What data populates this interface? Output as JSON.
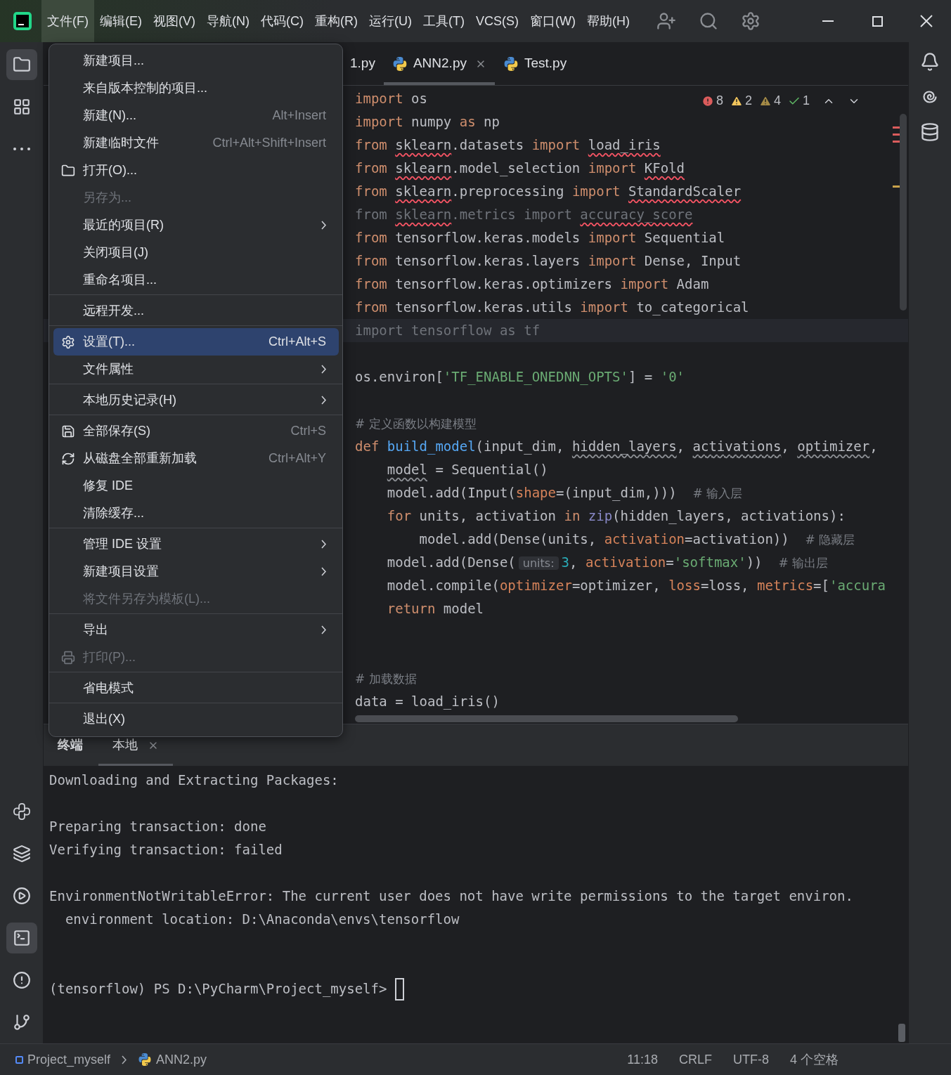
{
  "menubar": [
    {
      "label": "文件(F)",
      "selected": true
    },
    {
      "label": "编辑(E)",
      "selected": false
    },
    {
      "label": "视图(V)",
      "selected": false
    },
    {
      "label": "导航(N)",
      "selected": false
    },
    {
      "label": "代码(C)",
      "selected": false
    },
    {
      "label": "重构(R)",
      "selected": false
    },
    {
      "label": "运行(U)",
      "selected": false
    },
    {
      "label": "工具(T)",
      "selected": false
    },
    {
      "label": "VCS(S)",
      "selected": false
    },
    {
      "label": "窗口(W)",
      "selected": false
    },
    {
      "label": "帮助(H)",
      "selected": false
    }
  ],
  "tool_windows": {
    "top": [
      {
        "selected": true
      },
      {
        "selected": false
      },
      {
        "selected": false
      }
    ],
    "bottom": [
      {
        "selected": false
      },
      {
        "selected": false
      },
      {
        "selected": false
      },
      {
        "selected": true
      },
      {
        "selected": false
      },
      {
        "selected": false
      }
    ]
  },
  "editor": {
    "tabs": [
      {
        "label": "1.py",
        "selected": false,
        "python": false,
        "closable": false
      },
      {
        "label": "ANN2.py",
        "selected": true,
        "python": true,
        "closable": true
      },
      {
        "label": "Test.py",
        "selected": false,
        "python": true,
        "closable": false
      }
    ],
    "inspections": [
      {
        "kind": "error",
        "count": "8"
      },
      {
        "kind": "warning",
        "count": "2"
      },
      {
        "kind": "weak",
        "count": "4"
      },
      {
        "kind": "typo",
        "count": "1"
      }
    ],
    "lines": [
      {
        "kind": "code",
        "current": false,
        "tokens": [
          {
            "text": "import ",
            "kind": "kw"
          },
          {
            "text": "os",
            "kind": "plain"
          }
        ]
      },
      {
        "kind": "code",
        "current": false,
        "tokens": [
          {
            "text": "import ",
            "kind": "kw"
          },
          {
            "text": "numpy ",
            "kind": "plain"
          },
          {
            "text": "as ",
            "kind": "kw"
          },
          {
            "text": "np",
            "kind": "plain"
          }
        ]
      },
      {
        "kind": "code",
        "current": false,
        "tokens": [
          {
            "text": "from ",
            "kind": "kw"
          },
          {
            "text": "sklearn",
            "kind": "plain",
            "error": true
          },
          {
            "text": ".datasets ",
            "kind": "plain"
          },
          {
            "text": "import ",
            "kind": "kw"
          },
          {
            "text": "load_iris",
            "kind": "plain",
            "error": true
          }
        ]
      },
      {
        "kind": "code",
        "current": false,
        "tokens": [
          {
            "text": "from ",
            "kind": "kw"
          },
          {
            "text": "sklearn",
            "kind": "plain",
            "error": true
          },
          {
            "text": ".model_selection ",
            "kind": "plain"
          },
          {
            "text": "import ",
            "kind": "kw"
          },
          {
            "text": "KFold",
            "kind": "plain",
            "error": true
          }
        ]
      },
      {
        "kind": "code",
        "current": false,
        "tokens": [
          {
            "text": "from ",
            "kind": "kw"
          },
          {
            "text": "sklearn",
            "kind": "plain",
            "error": true
          },
          {
            "text": ".preprocessing ",
            "kind": "plain"
          },
          {
            "text": "import ",
            "kind": "kw"
          },
          {
            "text": "StandardScaler",
            "kind": "plain",
            "error": true
          }
        ]
      },
      {
        "kind": "code",
        "current": false,
        "tokens": [
          {
            "text": "from ",
            "kind": "dim"
          },
          {
            "text": "sklearn",
            "kind": "dim",
            "error": true
          },
          {
            "text": ".metrics import ",
            "kind": "dim"
          },
          {
            "text": "accuracy_score",
            "kind": "dim",
            "error": true
          }
        ]
      },
      {
        "kind": "code",
        "current": false,
        "tokens": [
          {
            "text": "from ",
            "kind": "kw"
          },
          {
            "text": "tensorflow.keras.models ",
            "kind": "plain"
          },
          {
            "text": "import ",
            "kind": "kw"
          },
          {
            "text": "Sequential",
            "kind": "plain"
          }
        ]
      },
      {
        "kind": "code",
        "current": false,
        "tokens": [
          {
            "text": "from ",
            "kind": "kw"
          },
          {
            "text": "tensorflow.keras.layers ",
            "kind": "plain"
          },
          {
            "text": "import ",
            "kind": "kw"
          },
          {
            "text": "Dense, Input",
            "kind": "plain"
          }
        ]
      },
      {
        "kind": "code",
        "current": false,
        "tokens": [
          {
            "text": "from ",
            "kind": "kw"
          },
          {
            "text": "tensorflow.keras.optimizers ",
            "kind": "plain"
          },
          {
            "text": "import ",
            "kind": "kw"
          },
          {
            "text": "Adam",
            "kind": "plain"
          }
        ]
      },
      {
        "kind": "code",
        "current": false,
        "tokens": [
          {
            "text": "from ",
            "kind": "kw"
          },
          {
            "text": "tensorflow.keras.utils ",
            "kind": "plain"
          },
          {
            "text": "import ",
            "kind": "kw"
          },
          {
            "text": "to_categorical",
            "kind": "plain"
          }
        ]
      },
      {
        "kind": "code",
        "current": true,
        "tokens": [
          {
            "text": "import tensorflow as tf",
            "kind": "dim"
          }
        ]
      },
      {
        "kind": "blank"
      },
      {
        "kind": "code",
        "current": false,
        "tokens": [
          {
            "text": "os.environ[",
            "kind": "plain"
          },
          {
            "text": "'TF_ENABLE_ONEDNN_OPTS'",
            "kind": "str"
          },
          {
            "text": "] = ",
            "kind": "plain"
          },
          {
            "text": "'0'",
            "kind": "str"
          }
        ]
      },
      {
        "kind": "blank"
      },
      {
        "kind": "code",
        "current": false,
        "tokens": [
          {
            "text": "# 定义函数以构建模型",
            "kind": "comment"
          }
        ]
      },
      {
        "kind": "code",
        "current": false,
        "tokens": [
          {
            "text": "def ",
            "kind": "kw"
          },
          {
            "text": "build_model",
            "kind": "fn"
          },
          {
            "text": "(input_dim, ",
            "kind": "plain"
          },
          {
            "text": "hidden_layers",
            "kind": "plain",
            "weak": true
          },
          {
            "text": ", ",
            "kind": "plain"
          },
          {
            "text": "activations",
            "kind": "plain",
            "weak": true
          },
          {
            "text": ", ",
            "kind": "plain"
          },
          {
            "text": "optimizer",
            "kind": "plain",
            "weak": true
          },
          {
            "text": ",",
            "kind": "plain"
          }
        ]
      },
      {
        "kind": "code",
        "current": false,
        "tokens": [
          {
            "text": "    model",
            "kind": "plain",
            "weak": true
          },
          {
            "text": " = Sequential()",
            "kind": "plain"
          }
        ]
      },
      {
        "kind": "code",
        "current": false,
        "tokens": [
          {
            "text": "    model.add(Input(",
            "kind": "plain"
          },
          {
            "text": "shape",
            "kind": "param"
          },
          {
            "text": "=(input_dim,)))  ",
            "kind": "plain"
          },
          {
            "text": "# 输入层",
            "kind": "comment"
          }
        ]
      },
      {
        "kind": "code",
        "current": false,
        "tokens": [
          {
            "text": "    for ",
            "kind": "kw"
          },
          {
            "text": "units, activation ",
            "kind": "plain"
          },
          {
            "text": "in ",
            "kind": "kw"
          },
          {
            "text": "zip",
            "kind": "builtin"
          },
          {
            "text": "(hidden_layers, activations):",
            "kind": "plain"
          }
        ]
      },
      {
        "kind": "code",
        "current": false,
        "tokens": [
          {
            "text": "        model.add(Dense(units, ",
            "kind": "plain"
          },
          {
            "text": "activation",
            "kind": "param"
          },
          {
            "text": "=activation))  ",
            "kind": "plain"
          },
          {
            "text": "# 隐藏层",
            "kind": "comment"
          }
        ]
      },
      {
        "kind": "code",
        "current": false,
        "tokens": [
          {
            "text": "    model.add(Dense(",
            "kind": "plain"
          },
          {
            "text": "units:",
            "kind": "hint"
          },
          {
            "text": "3",
            "kind": "num"
          },
          {
            "text": ", ",
            "kind": "plain"
          },
          {
            "text": "activation",
            "kind": "param"
          },
          {
            "text": "=",
            "kind": "plain"
          },
          {
            "text": "'softmax'",
            "kind": "str"
          },
          {
            "text": "))  ",
            "kind": "plain"
          },
          {
            "text": "# 输出层",
            "kind": "comment"
          }
        ]
      },
      {
        "kind": "code",
        "current": false,
        "tokens": [
          {
            "text": "    model.compile(",
            "kind": "plain"
          },
          {
            "text": "optimizer",
            "kind": "param"
          },
          {
            "text": "=optimizer, ",
            "kind": "plain"
          },
          {
            "text": "loss",
            "kind": "param"
          },
          {
            "text": "=loss, ",
            "kind": "plain"
          },
          {
            "text": "metrics",
            "kind": "param"
          },
          {
            "text": "=[",
            "kind": "plain"
          },
          {
            "text": "'accura",
            "kind": "str"
          }
        ]
      },
      {
        "kind": "code",
        "current": false,
        "tokens": [
          {
            "text": "    return ",
            "kind": "kw"
          },
          {
            "text": "model",
            "kind": "plain"
          }
        ]
      },
      {
        "kind": "blank"
      },
      {
        "kind": "blank"
      },
      {
        "kind": "code",
        "current": false,
        "tokens": [
          {
            "text": "# 加载数据",
            "kind": "comment"
          }
        ]
      },
      {
        "kind": "code",
        "current": false,
        "tokens": [
          {
            "text": "data = load_iris()",
            "kind": "plain"
          }
        ]
      }
    ]
  },
  "file_menu": {
    "groups": [
      {
        "items": [
          {
            "label": "新建项目...",
            "selected": false,
            "disabled": false,
            "submenu": false
          },
          {
            "label": "来自版本控制的项目...",
            "selected": false,
            "disabled": false,
            "submenu": false
          },
          {
            "label": "新建(N)...",
            "shortcut": "Alt+Insert",
            "selected": false,
            "disabled": false,
            "submenu": false
          },
          {
            "label": "新建临时文件",
            "shortcut": "Ctrl+Alt+Shift+Insert",
            "selected": false,
            "disabled": false,
            "submenu": false
          },
          {
            "label": "打开(O)...",
            "selected": false,
            "disabled": false,
            "submenu": false
          },
          {
            "label": "另存为...",
            "selected": false,
            "disabled": true,
            "submenu": false
          },
          {
            "label": "最近的项目(R)",
            "selected": false,
            "disabled": false,
            "submenu": true
          },
          {
            "label": "关闭项目(J)",
            "selected": false,
            "disabled": false,
            "submenu": false
          },
          {
            "label": "重命名项目...",
            "selected": false,
            "disabled": false,
            "submenu": false
          }
        ]
      },
      {
        "items": [
          {
            "label": "远程开发...",
            "selected": false,
            "disabled": false,
            "submenu": false
          }
        ]
      },
      {
        "items": [
          {
            "label": "设置(T)...",
            "shortcut": "Ctrl+Alt+S",
            "selected": true,
            "disabled": false,
            "submenu": false
          },
          {
            "label": "文件属性",
            "selected": false,
            "disabled": false,
            "submenu": true
          }
        ]
      },
      {
        "items": [
          {
            "label": "本地历史记录(H)",
            "selected": false,
            "disabled": false,
            "submenu": true
          }
        ]
      },
      {
        "items": [
          {
            "label": "全部保存(S)",
            "shortcut": "Ctrl+S",
            "selected": false,
            "disabled": false,
            "submenu": false
          },
          {
            "label": "从磁盘全部重新加载",
            "shortcut": "Ctrl+Alt+Y",
            "selected": false,
            "disabled": false,
            "submenu": false
          },
          {
            "label": "修复 IDE",
            "selected": false,
            "disabled": false,
            "submenu": false
          },
          {
            "label": "清除缓存...",
            "selected": false,
            "disabled": false,
            "submenu": false
          }
        ]
      },
      {
        "items": [
          {
            "label": "管理 IDE 设置",
            "selected": false,
            "disabled": false,
            "submenu": true
          },
          {
            "label": "新建项目设置",
            "selected": false,
            "disabled": false,
            "submenu": true
          },
          {
            "label": "将文件另存为模板(L)...",
            "selected": false,
            "disabled": true,
            "submenu": false
          }
        ]
      },
      {
        "items": [
          {
            "label": "导出",
            "selected": false,
            "disabled": false,
            "submenu": true
          },
          {
            "label": "打印(P)...",
            "selected": false,
            "disabled": true,
            "submenu": false
          }
        ]
      },
      {
        "items": [
          {
            "label": "省电模式",
            "selected": false,
            "disabled": false,
            "submenu": false
          }
        ]
      },
      {
        "items": [
          {
            "label": "退出(X)",
            "selected": false,
            "disabled": false,
            "submenu": false
          }
        ]
      }
    ]
  },
  "terminal": {
    "title": "终端",
    "tabs": [
      {
        "label": "本地",
        "selected": true
      }
    ],
    "lines": [
      {
        "kind": "text",
        "text": "Downloading and Extracting Packages:"
      },
      {
        "kind": "blank"
      },
      {
        "kind": "text",
        "text": "Preparing transaction: done"
      },
      {
        "kind": "text",
        "text": "Verifying transaction: failed"
      },
      {
        "kind": "blank"
      },
      {
        "kind": "text",
        "text": "EnvironmentNotWritableError: The current user does not have write permissions to the target environ."
      },
      {
        "kind": "text",
        "text": "  environment location: D:\\Anaconda\\envs\\tensorflow"
      },
      {
        "kind": "blank"
      },
      {
        "kind": "blank"
      },
      {
        "kind": "prompt",
        "text": "(tensorflow) PS D:\\PyCharm\\Project_myself>"
      }
    ]
  },
  "status_bar": {
    "breadcrumbs": [
      {
        "label": "Project_myself",
        "kind": "project"
      },
      {
        "label": "ANN2.py",
        "kind": "python"
      }
    ],
    "items": [
      "11:18",
      "CRLF",
      "UTF-8",
      "4 个空格"
    ]
  }
}
